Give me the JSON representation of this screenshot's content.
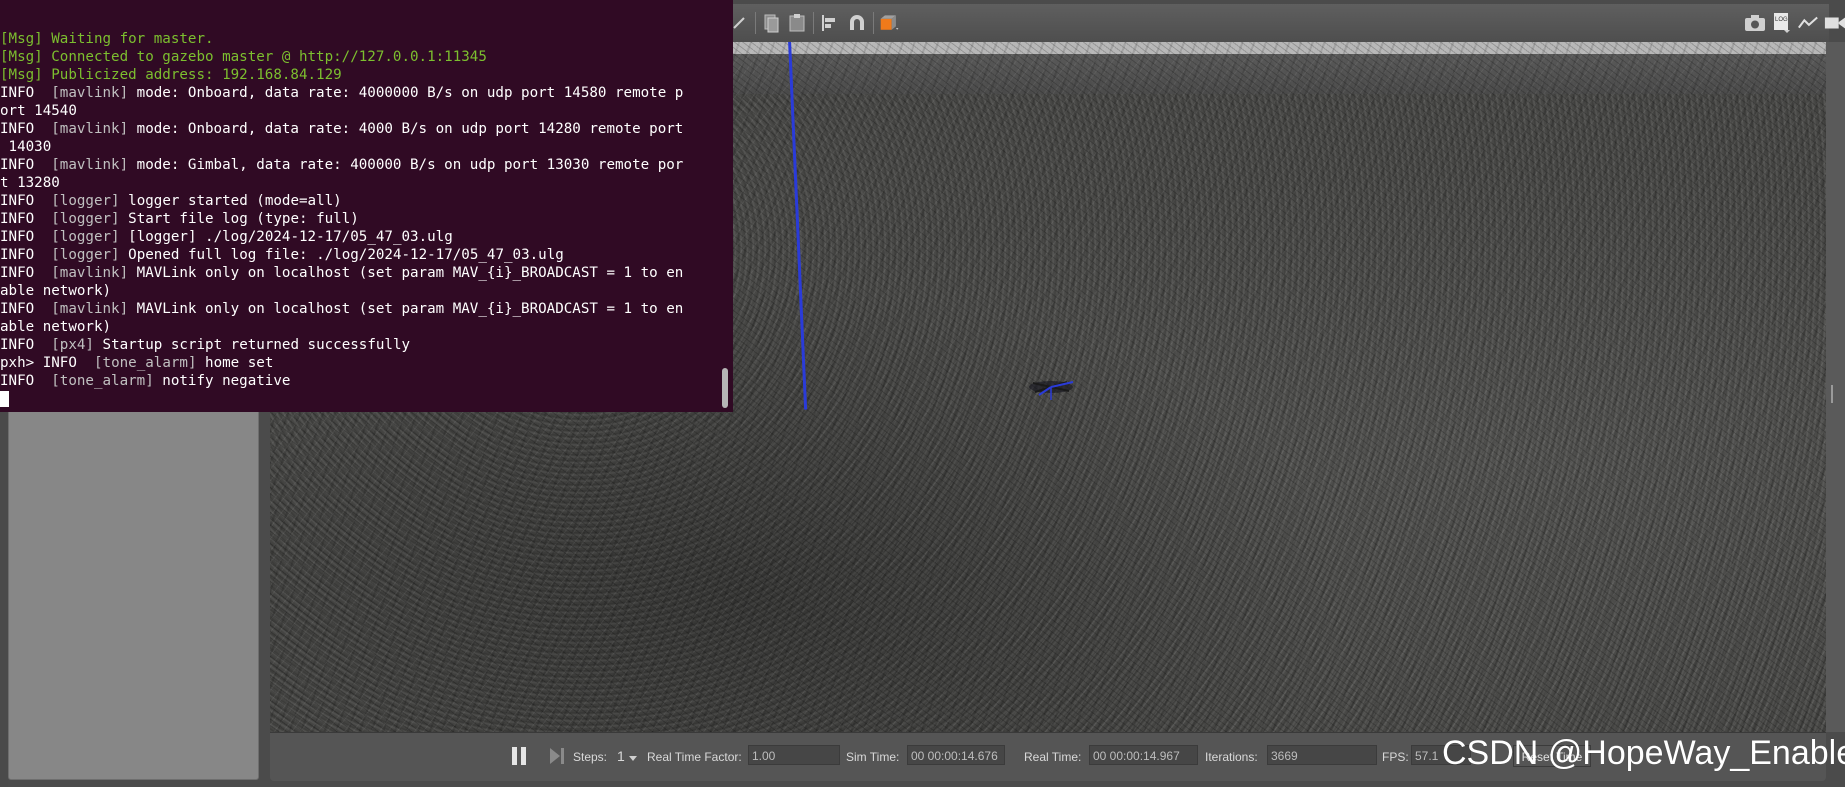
{
  "terminal": {
    "lines": [
      {
        "style": "green",
        "text": "[Msg] Waiting for master."
      },
      {
        "style": "green",
        "text": "[Msg] Connected to gazebo master @ http://127.0.0.1:11345"
      },
      {
        "style": "green",
        "text": "[Msg] Publicized address: 192.168.84.129"
      },
      {
        "level": "INFO",
        "tag": "[mavlink]",
        "text": " mode: Onboard, data rate: 4000000 B/s on udp port 14580 remote p"
      },
      {
        "style": "plain",
        "text": "ort 14540"
      },
      {
        "level": "INFO",
        "tag": "[mavlink]",
        "text": " mode: Onboard, data rate: 4000 B/s on udp port 14280 remote port"
      },
      {
        "style": "plain",
        "text": " 14030"
      },
      {
        "level": "INFO",
        "tag": "[mavlink]",
        "text": " mode: Gimbal, data rate: 400000 B/s on udp port 13030 remote por"
      },
      {
        "style": "plain",
        "text": "t 13280"
      },
      {
        "level": "INFO",
        "tag": "[logger]",
        "text": " logger started (mode=all)"
      },
      {
        "level": "INFO",
        "tag": "[logger]",
        "text": " Start file log (type: full)"
      },
      {
        "level": "INFO",
        "tag": "[logger]",
        "text": " [logger] ./log/2024-12-17/05_47_03.ulg"
      },
      {
        "level": "INFO",
        "tag": "[logger]",
        "text": " Opened full log file: ./log/2024-12-17/05_47_03.ulg"
      },
      {
        "level": "INFO",
        "tag": "[mavlink]",
        "text": " MAVLink only on localhost (set param MAV_{i}_BROADCAST = 1 to en"
      },
      {
        "style": "plain",
        "text": "able network)"
      },
      {
        "level": "INFO",
        "tag": "[mavlink]",
        "text": " MAVLink only on localhost (set param MAV_{i}_BROADCAST = 1 to en"
      },
      {
        "style": "plain",
        "text": "able network)"
      },
      {
        "level": "INFO",
        "tag": "[px4]",
        "text": " Startup script returned successfully"
      },
      {
        "prefix": "pxh> ",
        "level": "INFO",
        "tag": "[tone_alarm]",
        "text": " home set"
      },
      {
        "level": "INFO",
        "tag": "[tone_alarm]",
        "text": " notify negative"
      }
    ]
  },
  "toolbar": {
    "icons": [
      "edit-icon",
      "copy-icon",
      "paste-icon",
      "align-icon",
      "magnet-icon",
      "model-icon",
      "screenshot-icon",
      "log-icon",
      "plot-icon",
      "video-icon"
    ],
    "log_label": "LOG"
  },
  "bottom_bar": {
    "steps_label": "Steps:",
    "steps_value": "1",
    "rtf_label": "Real Time Factor:",
    "rtf_value": "1.00",
    "sim_time_label": "Sim Time:",
    "sim_time_value": "00 00:00:14.676",
    "real_time_label": "Real Time:",
    "real_time_value": "00 00:00:14.967",
    "iterations_label": "Iterations:",
    "iterations_value": "3669",
    "fps_label": "FPS:",
    "fps_value": "57.1",
    "reset_label": "Reset Time"
  },
  "watermark": "CSDN @HopeWay_Enable",
  "colors": {
    "terminal_bg": "#300a24",
    "terminal_green": "#7cbf2f",
    "axis_blue": "#2a3bd9"
  }
}
